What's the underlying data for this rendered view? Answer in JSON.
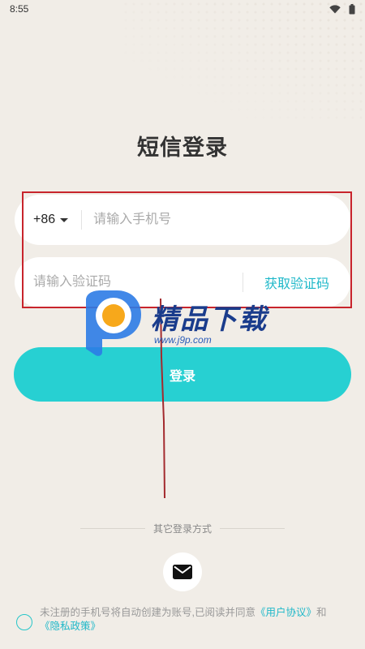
{
  "status_bar": {
    "time": "8:55",
    "icons": [
      "wifi-icon",
      "battery-icon"
    ]
  },
  "title": "短信登录",
  "phone": {
    "country_code": "+86",
    "placeholder": "请输入手机号",
    "value": ""
  },
  "code": {
    "placeholder": "请输入验证码",
    "value": "",
    "get_code_label": "获取验证码"
  },
  "login_button": "登录",
  "watermark": {
    "title": "精品下载",
    "url": "www.j9p.com"
  },
  "other_login": {
    "label": "其它登录方式",
    "methods": [
      "mail-icon"
    ]
  },
  "agreement": {
    "text": "未注册的手机号将自动创建为账号,已阅读并同意",
    "user_agreement": "《用户协议》",
    "and": "和",
    "privacy_policy": "《隐私政策》"
  },
  "colors": {
    "background": "#f1ede7",
    "accent": "#27d0d2",
    "link": "#1fb8c9",
    "highlight": "#c8242c"
  }
}
